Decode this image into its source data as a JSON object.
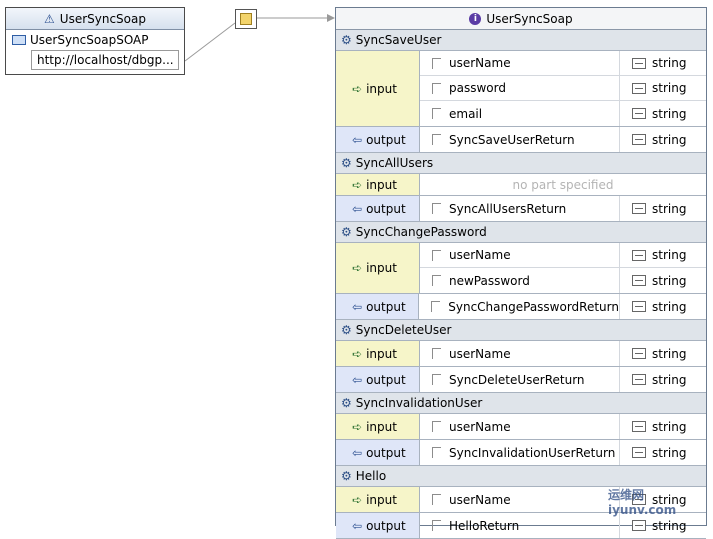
{
  "service": {
    "icon": "service-icon",
    "title": "UserSyncSoap",
    "port_name": "UserSyncSoapSOAP",
    "endpoint": "http://localhost/dbgp..."
  },
  "interface": {
    "icon": "info-icon",
    "title": "UserSyncSoap",
    "input_label": "input",
    "output_label": "output",
    "no_part_text": "no part specified",
    "operations": [
      {
        "name": "SyncSaveUser",
        "inputs": [
          {
            "name": "userName",
            "type": "string"
          },
          {
            "name": "password",
            "type": "string"
          },
          {
            "name": "email",
            "type": "string"
          }
        ],
        "outputs": [
          {
            "name": "SyncSaveUserReturn",
            "type": "string"
          }
        ]
      },
      {
        "name": "SyncAllUsers",
        "inputs": [],
        "outputs": [
          {
            "name": "SyncAllUsersReturn",
            "type": "string"
          }
        ]
      },
      {
        "name": "SyncChangePassword",
        "inputs": [
          {
            "name": "userName",
            "type": "string"
          },
          {
            "name": "newPassword",
            "type": "string"
          }
        ],
        "outputs": [
          {
            "name": "SyncChangePasswordReturn",
            "type": "string"
          }
        ]
      },
      {
        "name": "SyncDeleteUser",
        "inputs": [
          {
            "name": "userName",
            "type": "string"
          }
        ],
        "outputs": [
          {
            "name": "SyncDeleteUserReturn",
            "type": "string"
          }
        ]
      },
      {
        "name": "SyncInvalidationUser",
        "inputs": [
          {
            "name": "userName",
            "type": "string"
          }
        ],
        "outputs": [
          {
            "name": "SyncInvalidationUserReturn",
            "type": "string"
          }
        ]
      },
      {
        "name": "Hello",
        "inputs": [
          {
            "name": "userName",
            "type": "string"
          }
        ],
        "outputs": [
          {
            "name": "HelloReturn",
            "type": "string"
          }
        ]
      }
    ]
  },
  "watermark": "运维网 iyunv.com"
}
